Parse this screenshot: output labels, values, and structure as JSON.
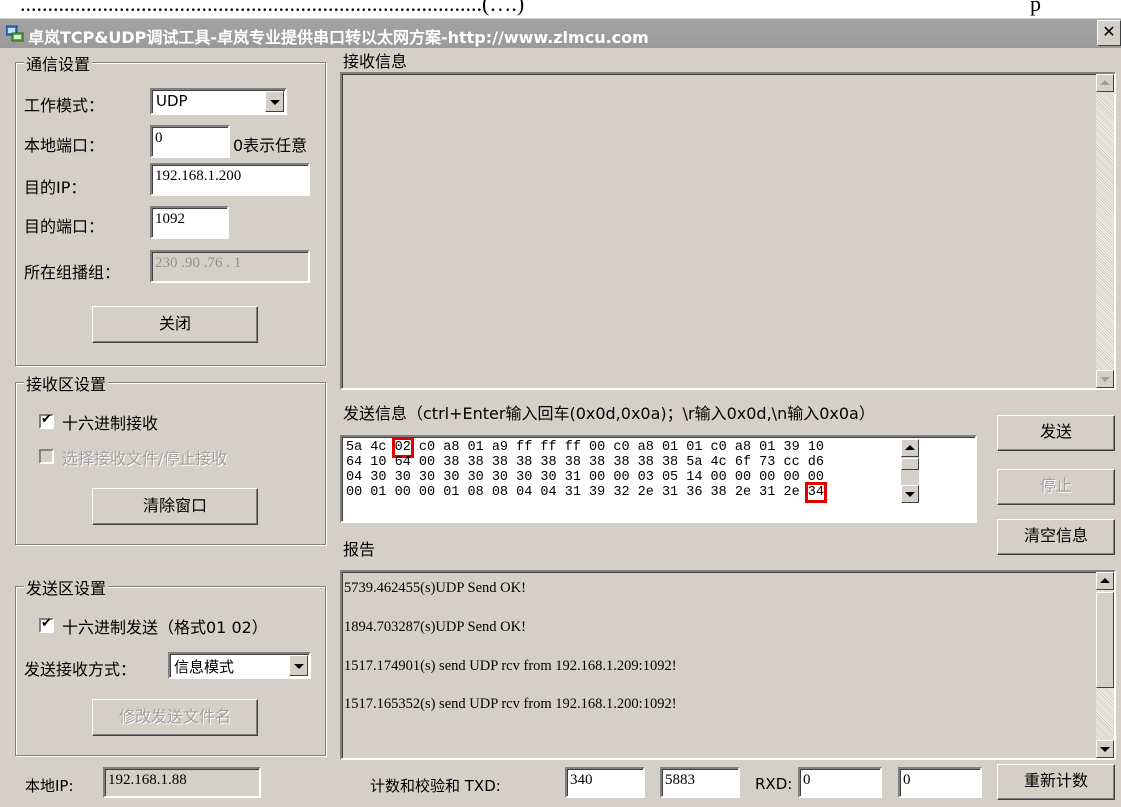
{
  "top_strip": {
    "left_text": "....................................................................................(….)",
    "right_text": "p"
  },
  "window": {
    "title": "卓岚TCP&UDP调试工具-卓岚专业提供串口转以太网方案-http://www.zlmcu.com",
    "close_glyph": "✕"
  },
  "comm": {
    "legend": "通信设置",
    "mode_label": "工作模式：",
    "mode_value": "UDP",
    "local_port_label": "本地端口：",
    "local_port_value": "0",
    "local_port_hint": "0表示任意",
    "dest_ip_label": "目的IP：",
    "dest_ip_value": "192.168.1.200",
    "dest_port_label": "目的端口：",
    "dest_port_value": "1092",
    "multicast_label": "所在组播组：",
    "multicast_value": "230 .90  .76  . 1",
    "close_button": "关闭"
  },
  "recv_settings": {
    "legend": "接收区设置",
    "hex_recv_label": "十六进制接收",
    "hex_recv_checked": true,
    "select_file_label": "选择接收文件/停止接收",
    "select_file_checked": false,
    "clear_button": "清除窗口"
  },
  "send_settings": {
    "legend": "发送区设置",
    "hex_send_label": "十六进制发送（格式01 02）",
    "hex_send_checked": true,
    "mode_label": "发送接收方式：",
    "mode_value": "信息模式",
    "modify_button": "修改发送文件名"
  },
  "recv_info": {
    "label": "接收信息"
  },
  "send_info": {
    "label": "发送信息（ctrl+Enter输入回车(0x0d,0x0a)；\\r输入0x0d,\\n输入0x0a）",
    "line1_a": "5a 4c ",
    "line1_hl": "02",
    "line1_b": " c0 a8 01 a9 ff ff ff 00 c0 a8 01 01 c0 a8 01 39 10",
    "line2": "64 10 64 00 38 38 38 38 38 38 38 38 38 38 5a 4c 6f 73 cc d6",
    "line3": "04 30 30 30 30 30 30 30 30 31 00 00 03 05 14 00 00 00 00 00",
    "line4_a": "00 01 00 00 01 08 08 04 04 31 39 32 2e 31 36 38 2e 31 2e ",
    "line4_hl": "34"
  },
  "right_buttons": {
    "send": "发送",
    "stop": "停止",
    "clear_info": "清空信息"
  },
  "report": {
    "label": "报告",
    "lines": [
      "5739.462455(s)UDP Send OK!",
      "1894.703287(s)UDP Send OK!",
      "1517.174901(s) send UDP rcv from 192.168.1.209:1092!",
      "1517.165352(s) send UDP rcv from 192.168.1.200:1092!"
    ]
  },
  "status": {
    "local_ip_label": "本地IP:",
    "local_ip_value": "192.168.1.88",
    "checksum_label": "计数和校验和 TXD:",
    "txd_count": "340",
    "txd_sum": "5883",
    "rxd_label": "RXD:",
    "rxd_count": "0",
    "rxd_sum": "0",
    "recount_button": "重新计数"
  },
  "colors": {
    "highlight": "#e00000",
    "face": "#d4d0c8",
    "titlebar": "#9e9e9e"
  }
}
